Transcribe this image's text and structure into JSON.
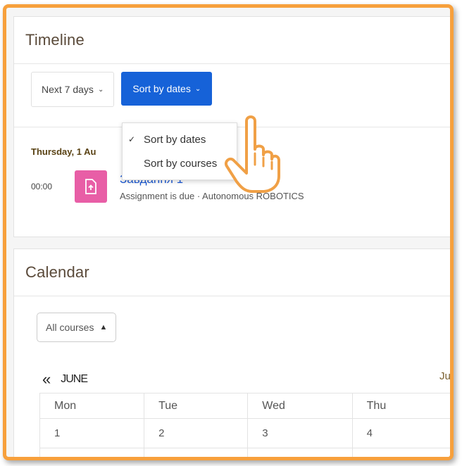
{
  "timeline": {
    "title": "Timeline",
    "filter_label": "Next 7 days",
    "sort_label": "Sort by dates",
    "sort_menu": [
      {
        "label": "Sort by dates",
        "checked": true
      },
      {
        "label": "Sort by courses",
        "checked": false
      }
    ],
    "date_heading": "Thursday, 1 Au",
    "event": {
      "time": "00:00",
      "title": "Завдання 1",
      "subtitle": "Assignment is due · Autonomous ROBOTICS",
      "icon": "assignment-upload-icon",
      "icon_color": "#e85ea6"
    }
  },
  "calendar": {
    "title": "Calendar",
    "course_select": "All courses",
    "prev_symbol": "«",
    "month": "JUNE",
    "next_month": "July",
    "days": [
      "Mon",
      "Tue",
      "Wed",
      "Thu"
    ],
    "week1": [
      "1",
      "2",
      "3",
      "4"
    ]
  },
  "colors": {
    "frame": "#f7a03c",
    "primary_button": "#1662d8",
    "link": "#1e5bd6"
  }
}
